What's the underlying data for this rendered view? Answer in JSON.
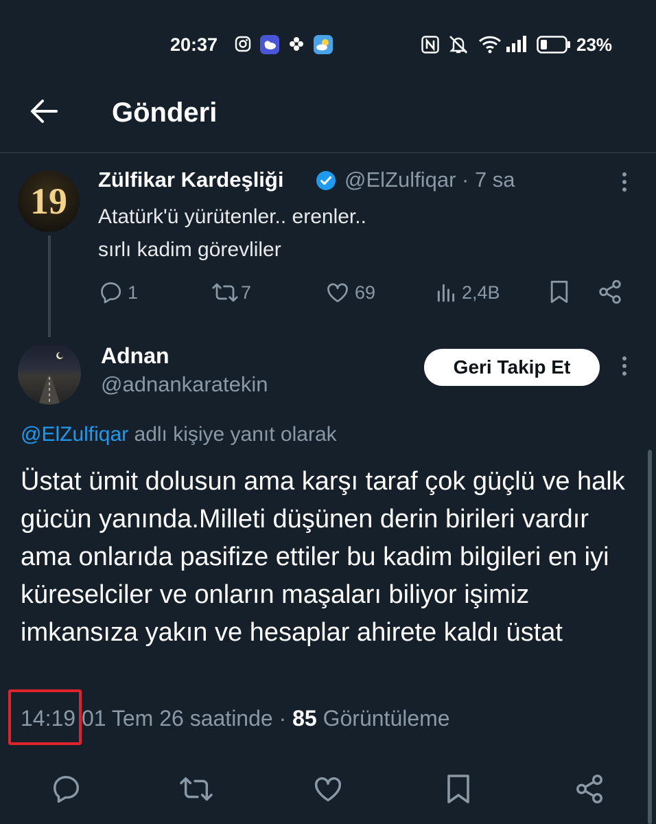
{
  "status_bar": {
    "time": "20:37",
    "battery_percent": "23%",
    "icons": [
      "instagram-icon",
      "weather-app-icon",
      "pinwheel-icon",
      "weather-icon",
      "nfc-icon",
      "mute-icon",
      "wifi-icon",
      "signal-icon",
      "battery-icon"
    ]
  },
  "header": {
    "title": "Gönderi",
    "back_icon": "arrow-left-icon"
  },
  "quoted_tweet": {
    "avatar_text": "19",
    "author_name": "Zülfikar Kardeşliği",
    "verified": true,
    "handle_time": "@ElZulfiqar · 7 sa",
    "text_line1": "Atatürk'ü yürütenler.. erenler..",
    "text_line2": "sırlı kadim görevliler",
    "replies": "1",
    "retweets": "7",
    "likes": "69",
    "views": "2,4B"
  },
  "reply_tweet": {
    "author_name": "Adnan",
    "handle": "@adnankaratekin",
    "follow_button": "Geri Takip Et",
    "reply_to_mention": "@ElZulfiqar",
    "reply_to_suffix": " adlı kişiye yanıt olarak",
    "body": "Üstat ümit dolusun ama  karşı taraf çok güçlü ve halk gücün yanında.Milleti düşünen derin birileri vardır ama onlarıda pasifize ettiler bu kadim bilgileri en iyi küreselciler ve onların maşaları biliyor işimiz imkansıza yakın ve hesaplar ahirete kaldı üstat",
    "time": "14:19",
    "date_text": " 01 Tem 26 saatinde · ",
    "views_count": "85",
    "views_label": " Görüntüleme"
  },
  "colors": {
    "background": "#15202b",
    "accent": "#1d9bf0",
    "secondary_text": "#8b98a5",
    "highlight_box": "#e0222a"
  }
}
